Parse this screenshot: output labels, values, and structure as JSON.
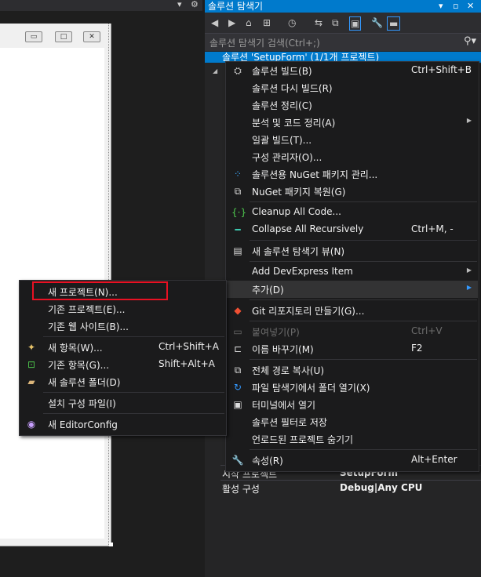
{
  "editor": {
    "pin_glyph": "▾",
    "gear_glyph": "⚙"
  },
  "form_window": {
    "minimize_glyph": "▭",
    "maximize_glyph": "□",
    "close_glyph": "✕"
  },
  "solution_explorer": {
    "title": "솔루션 탐색기",
    "title_dropdown": "▾",
    "title_pin": "▫",
    "title_close": "✕",
    "search_placeholder": "솔루션 탐색기 검색(Ctrl+;)",
    "selected_item": "솔루션 'SetupForm' (1/1개 프로젝트)",
    "toolbar": {
      "back": "◀",
      "forward": "▶",
      "home": "⌂",
      "switch_views": "⊞",
      "history": "◷",
      "sync": "⇆",
      "collapse": "⧉",
      "show_all": "▣",
      "properties": "🔧",
      "preview": "▬"
    },
    "properties": [
      {
        "key": "시작 프로젝트",
        "value": "SetupForm"
      },
      {
        "key": "활성 구성",
        "value": "Debug|Any CPU"
      }
    ]
  },
  "context_menu": {
    "items": [
      {
        "label": "솔루션 빌드(B)",
        "shortcut": "Ctrl+Shift+B",
        "icon": "build-icon"
      },
      {
        "label": "솔루션 다시 빌드(R)",
        "shortcut": ""
      },
      {
        "label": "솔루션 정리(C)",
        "shortcut": ""
      },
      {
        "label": "분석 및 코드 정리(A)",
        "shortcut": "",
        "submenu": true
      },
      {
        "label": "일괄 빌드(T)...",
        "shortcut": ""
      },
      {
        "label": "구성 관리자(O)...",
        "shortcut": ""
      },
      {
        "label": "솔루션용 NuGet 패키지 관리...",
        "shortcut": "",
        "icon": "nuget-icon"
      },
      {
        "label": "NuGet 패키지 복원(G)",
        "shortcut": "",
        "icon": "restore-icon"
      },
      {
        "label": "Cleanup All Code...",
        "shortcut": "",
        "icon": "cleanup-icon"
      },
      {
        "label": "Collapse All Recursively",
        "shortcut": "Ctrl+M, -",
        "icon": "collapse-icon"
      },
      {
        "label": "새 솔루션 탐색기 뷰(N)",
        "shortcut": "",
        "icon": "new-view-icon"
      },
      {
        "label": "Add DevExpress Item",
        "shortcut": "",
        "submenu": true
      },
      {
        "label": "추가(D)",
        "shortcut": "",
        "submenu": true
      },
      {
        "label": "Git 리포지토리 만들기(G)...",
        "shortcut": "",
        "icon": "git-icon"
      },
      {
        "label": "붙여넣기(P)",
        "shortcut": "Ctrl+V",
        "disabled": true,
        "icon": "paste-icon"
      },
      {
        "label": "이름 바꾸기(M)",
        "shortcut": "F2",
        "icon": "rename-icon"
      },
      {
        "label": "전체 경로 복사(U)",
        "shortcut": "",
        "icon": "copy-icon"
      },
      {
        "label": "파일 탐색기에서 폴더 열기(X)",
        "shortcut": "",
        "icon": "open-folder-icon"
      },
      {
        "label": "터미널에서 열기",
        "shortcut": "",
        "icon": "terminal-icon"
      },
      {
        "label": "솔루션 필터로 저장",
        "shortcut": ""
      },
      {
        "label": "언로드된 프로젝트 숨기기",
        "shortcut": ""
      },
      {
        "label": "속성(R)",
        "shortcut": "Alt+Enter",
        "icon": "wrench-icon"
      }
    ]
  },
  "add_submenu": {
    "items": [
      {
        "label": "새 프로젝트(N)...",
        "shortcut": ""
      },
      {
        "label": "기존 프로젝트(E)...",
        "shortcut": ""
      },
      {
        "label": "기존 웹 사이트(B)...",
        "shortcut": ""
      },
      {
        "label": "새 항목(W)...",
        "shortcut": "Ctrl+Shift+A",
        "icon": "new-item-icon"
      },
      {
        "label": "기존 항목(G)...",
        "shortcut": "Shift+Alt+A",
        "icon": "existing-item-icon"
      },
      {
        "label": "새 솔루션 폴더(D)",
        "shortcut": "",
        "icon": "new-folder-icon"
      },
      {
        "label": "설치 구성 파일(I)",
        "shortcut": ""
      },
      {
        "label": "새 EditorConfig",
        "shortcut": "",
        "icon": "editorconfig-icon"
      }
    ]
  },
  "colors": {
    "accent": "#007acc",
    "menu_bg": "#1b1b1c",
    "highlight_box": "#e81123"
  }
}
